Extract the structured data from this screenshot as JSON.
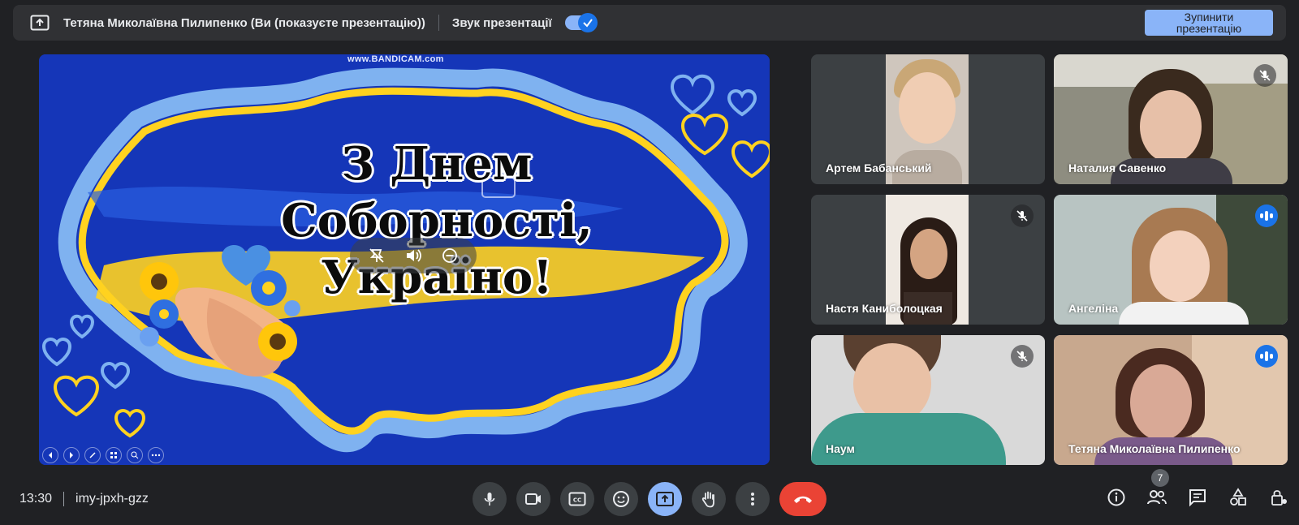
{
  "banner": {
    "presenter_text": "Тетяна Миколаївна Пилипенко (Ви (показуєте презентацію))",
    "sound_label": "Звук презентації",
    "sound_on": true,
    "stop_button": "Зупинити презентацію"
  },
  "slide": {
    "watermark": "www.BANDICAM.com",
    "title_line1": "З Днем",
    "title_line2": "Соборності,",
    "title_line3": "Україно!",
    "colors": {
      "background": "#1536b8",
      "yellow": "#ffd21f",
      "light_blue": "#7fb2f0"
    }
  },
  "participants": [
    {
      "name": "Артем Бабанський",
      "muted": false,
      "speaking": false
    },
    {
      "name": "Наталия Савенко",
      "muted": true,
      "speaking": false
    },
    {
      "name": "Настя Каниболоцкая",
      "muted": true,
      "speaking": false
    },
    {
      "name": "Ангеліна",
      "muted": false,
      "speaking": true
    },
    {
      "name": "Наум",
      "muted": true,
      "speaking": false
    },
    {
      "name": "Тетяна Миколаївна Пилипенко",
      "muted": false,
      "speaking": true
    }
  ],
  "bottom": {
    "time": "13:30",
    "meeting_code": "imy-jpxh-gzz",
    "participant_count": "7",
    "controls": [
      "mic-icon",
      "camera-icon",
      "captions-icon",
      "emoji-icon",
      "present-icon",
      "raise-hand-icon",
      "more-icon",
      "end-call-icon"
    ],
    "right_controls": [
      "info-icon",
      "people-icon",
      "chat-icon",
      "activities-icon",
      "host-controls-icon"
    ],
    "colors": {
      "accent": "#8ab4f8",
      "end_call": "#ea4335"
    }
  }
}
